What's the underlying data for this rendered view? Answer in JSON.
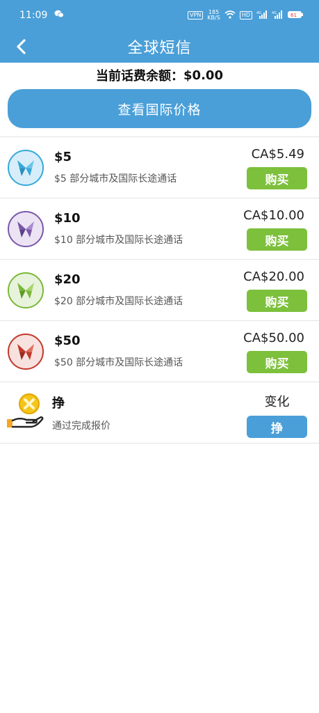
{
  "status_bar": {
    "time": "11:09",
    "vpn": "VPN",
    "net_speed": "185\nKB/S",
    "hd": "HD",
    "signal_1": "4G",
    "signal_2": "4G",
    "battery": "61"
  },
  "header": {
    "title": "全球短信"
  },
  "balance": {
    "label": "当前话费余额：",
    "amount": "$0.00"
  },
  "intl_button": {
    "label": "查看国际价格"
  },
  "plans": [
    {
      "title": "$5",
      "desc": "$5 部分城市及国际长途通话",
      "price": "CA$5.49",
      "buy": "购买",
      "color": "#36a9d9",
      "bg": "#d7eefa"
    },
    {
      "title": "$10",
      "desc": "$10 部分城市及国际长途通话",
      "price": "CA$10.00",
      "buy": "购买",
      "color": "#7a58a8",
      "bg": "#ece4f4"
    },
    {
      "title": "$20",
      "desc": "$20 部分城市及国际长途通话",
      "price": "CA$20.00",
      "buy": "购买",
      "color": "#7bb73a",
      "bg": "#e8f3dc"
    },
    {
      "title": "$50",
      "desc": "$50 部分城市及国际长途通话",
      "price": "CA$50.00",
      "buy": "购买",
      "color": "#c0392b",
      "bg": "#f8e2df"
    }
  ],
  "earn": {
    "title": "挣",
    "desc": "通过完成报价",
    "change": "变化",
    "button": "挣"
  },
  "colors": {
    "primary": "#4a9fd8",
    "buy": "#7dc03c"
  }
}
